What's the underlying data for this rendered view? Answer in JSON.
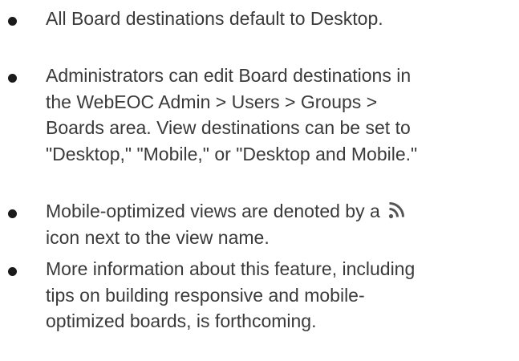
{
  "bullets": [
    {
      "lines": [
        "All Board destinations default to Desktop."
      ]
    },
    {
      "lines": [
        "Administrators can edit Board destinations in",
        "the WebEOC Admin > Users > Groups >",
        "Boards area. View destinations can be set to",
        "\"Desktop,\" \"Mobile,\" or \"Desktop and Mobile.\""
      ]
    },
    {
      "line1": "Mobile-optimized views are denoted by a",
      "line2": "icon next to the view name.",
      "icon": "rss-icon"
    },
    {
      "lines": [
        "More information about this feature, including",
        "tips on building responsive and mobile-",
        "optimized boards, is forthcoming."
      ]
    }
  ],
  "colors": {
    "text": "#3a3a3a",
    "bullet": "#1a1a1a",
    "icon": "#555555"
  }
}
